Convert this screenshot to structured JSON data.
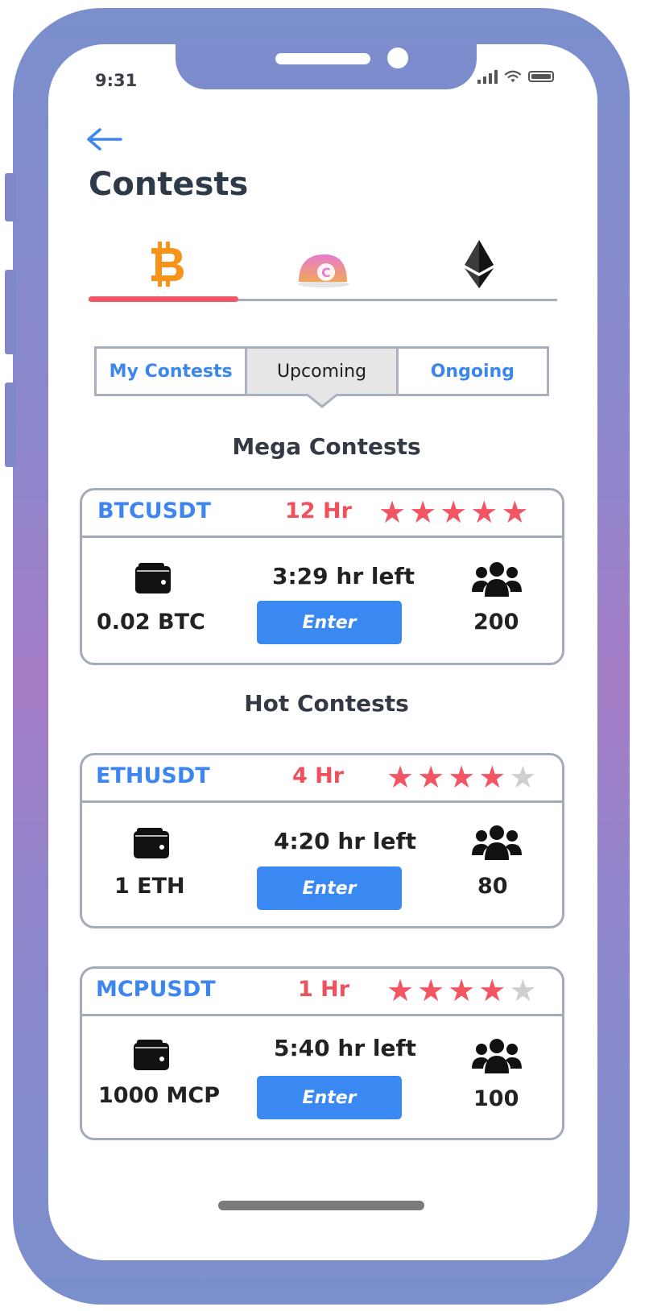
{
  "status_bar": {
    "time": "9:31"
  },
  "header": {
    "title": "Contests"
  },
  "coin_tabs": [
    {
      "name": "Bitcoin",
      "icon": "bitcoin-icon",
      "active": true
    },
    {
      "name": "Coin",
      "icon": "c-coin-icon",
      "active": false
    },
    {
      "name": "Ethereum",
      "icon": "ethereum-icon",
      "active": false
    }
  ],
  "segments": [
    "My Contests",
    "Upcoming",
    "Ongoing"
  ],
  "selected_segment": "Upcoming",
  "sections": {
    "mega": "Mega Contests",
    "hot": "Hot Contests"
  },
  "contests": [
    {
      "pair": "BTCUSDT",
      "duration": "12 Hr",
      "rating": 5,
      "time_left": "3:29 hr left",
      "prize": "0.02 BTC",
      "participants": "200",
      "enter_label": "Enter"
    },
    {
      "pair": "ETHUSDT",
      "duration": "4 Hr",
      "rating": 4,
      "time_left": "4:20 hr left",
      "prize": "1 ETH",
      "participants": "80",
      "enter_label": "Enter"
    },
    {
      "pair": "MCPUSDT",
      "duration": "1 Hr",
      "rating": 4,
      "time_left": "5:40 hr left",
      "prize": "1000 MCP",
      "participants": "100",
      "enter_label": "Enter"
    }
  ],
  "colors": {
    "accent_blue": "#3a88f2",
    "star_red": "#f25563",
    "star_gray": "#cfcfcf",
    "tab_active": "#f25563"
  }
}
